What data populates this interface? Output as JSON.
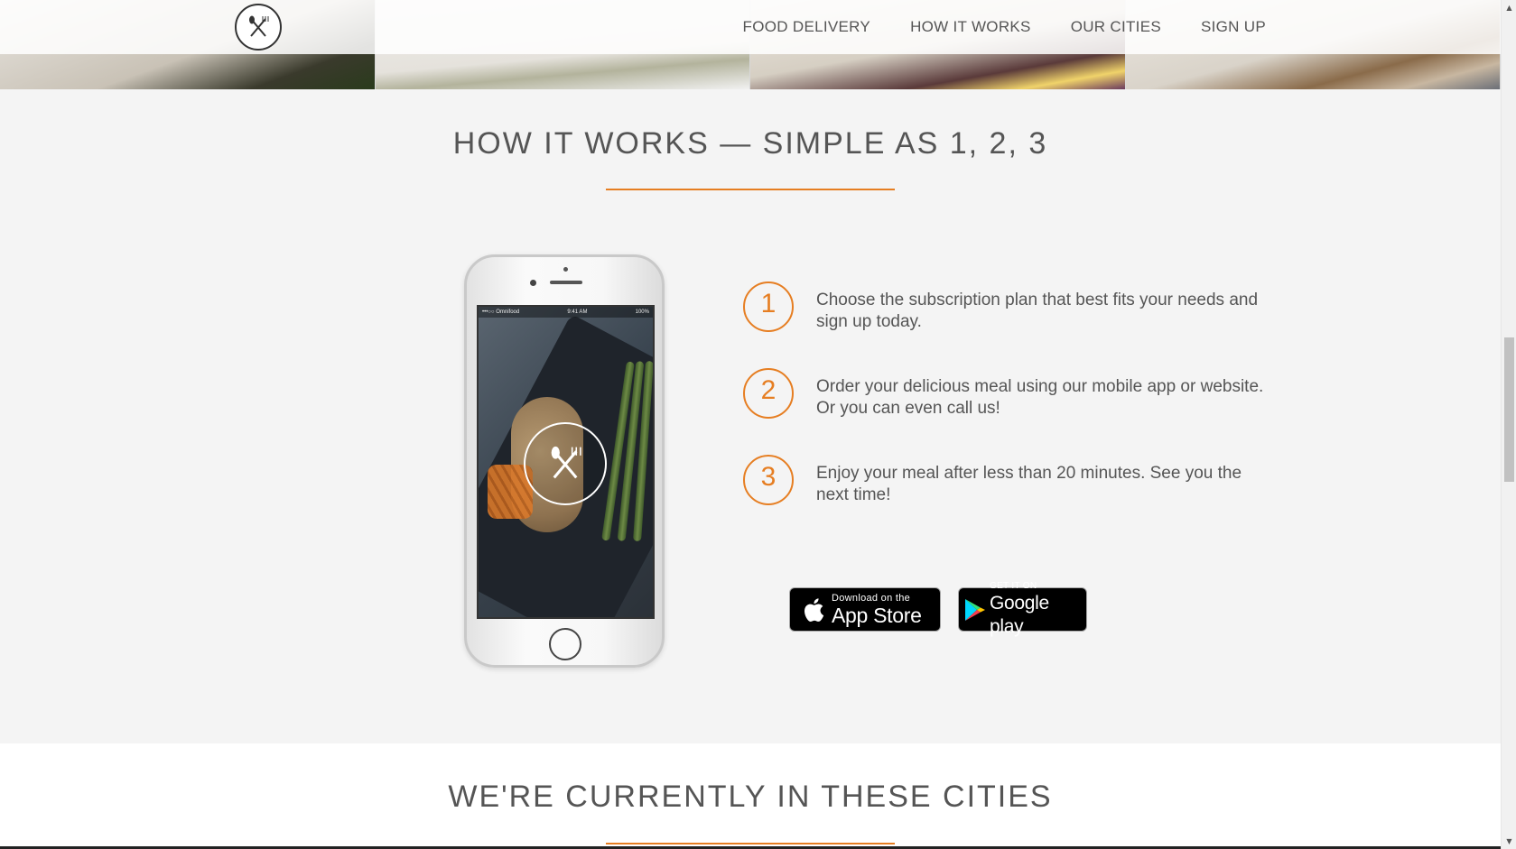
{
  "nav": {
    "logo_icon": "fork-knife-logo-icon",
    "links": [
      "FOOD DELIVERY",
      "HOW IT WORKS",
      "OUR CITIES",
      "SIGN UP"
    ]
  },
  "how_it_works": {
    "title": "HOW IT WORKS — SIMPLE AS 1, 2, 3",
    "accent_color": "#e67e22",
    "steps": [
      {
        "number": "1",
        "text": "Choose the subscription plan that best fits your needs and sign up today."
      },
      {
        "number": "2",
        "text": "Order your delicious meal using our mobile app or website. Or you can even call us!"
      },
      {
        "number": "3",
        "text": "Enjoy your meal after less than 20 minutes. See you the next time!"
      }
    ],
    "phone": {
      "status_left": "•••○○ Omnifood",
      "status_time": "9:41 AM",
      "status_battery": "100%"
    },
    "badges": {
      "apple": {
        "small": "Download on the",
        "big": "App Store",
        "icon": "apple-icon"
      },
      "google": {
        "small": "GET IT ON",
        "big": "Google play",
        "icon": "google-play-icon"
      }
    }
  },
  "cities": {
    "title": "WE'RE CURRENTLY IN THESE CITIES"
  },
  "scrollbar": {
    "up_arrow": "▲",
    "down_arrow": "▼"
  }
}
